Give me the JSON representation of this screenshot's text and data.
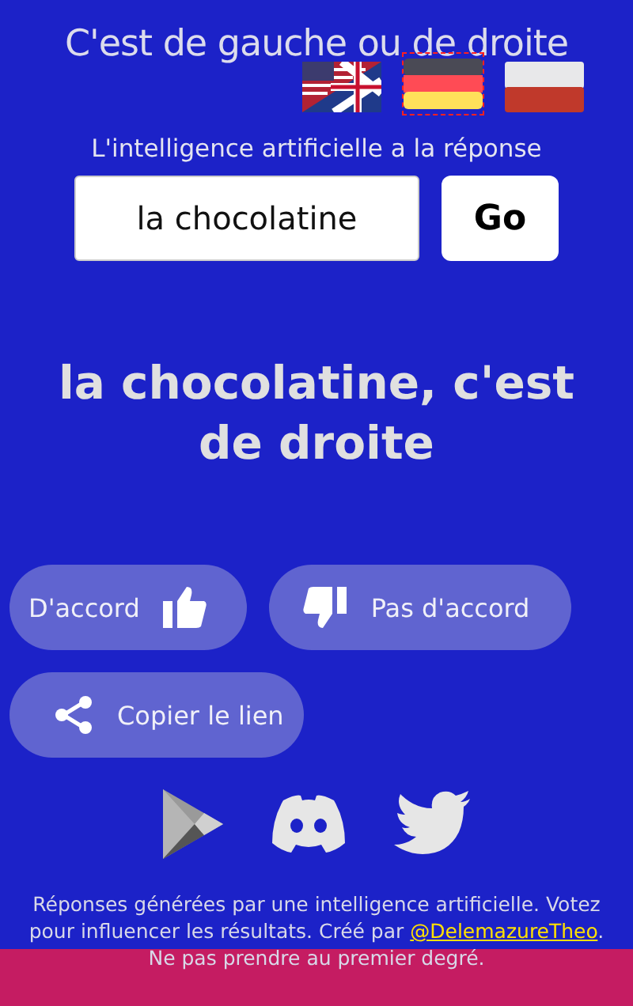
{
  "title": "C'est de gauche ou de droite",
  "languages": [
    {
      "kind": "en",
      "selected": false
    },
    {
      "kind": "de",
      "selected": true
    },
    {
      "kind": "pl",
      "selected": false
    }
  ],
  "subtitle": "L'intelligence artificielle a la réponse",
  "search": {
    "value": "la chocolatine",
    "button": "Go"
  },
  "answer": "la chocolatine, c'est de droite",
  "actions": [
    {
      "kind": "agree",
      "label": "D'accord"
    },
    {
      "kind": "disagree",
      "label": "Pas d'accord"
    },
    {
      "kind": "share",
      "label": "Copier le lien"
    }
  ],
  "footer": {
    "text": "Réponses générées par une intelligence artificielle. Votez pour influencer les résultats. Créé par",
    "link": "@DelemazureTheo",
    "after": ".",
    "note": "Ne pas prendre au premier degré."
  }
}
